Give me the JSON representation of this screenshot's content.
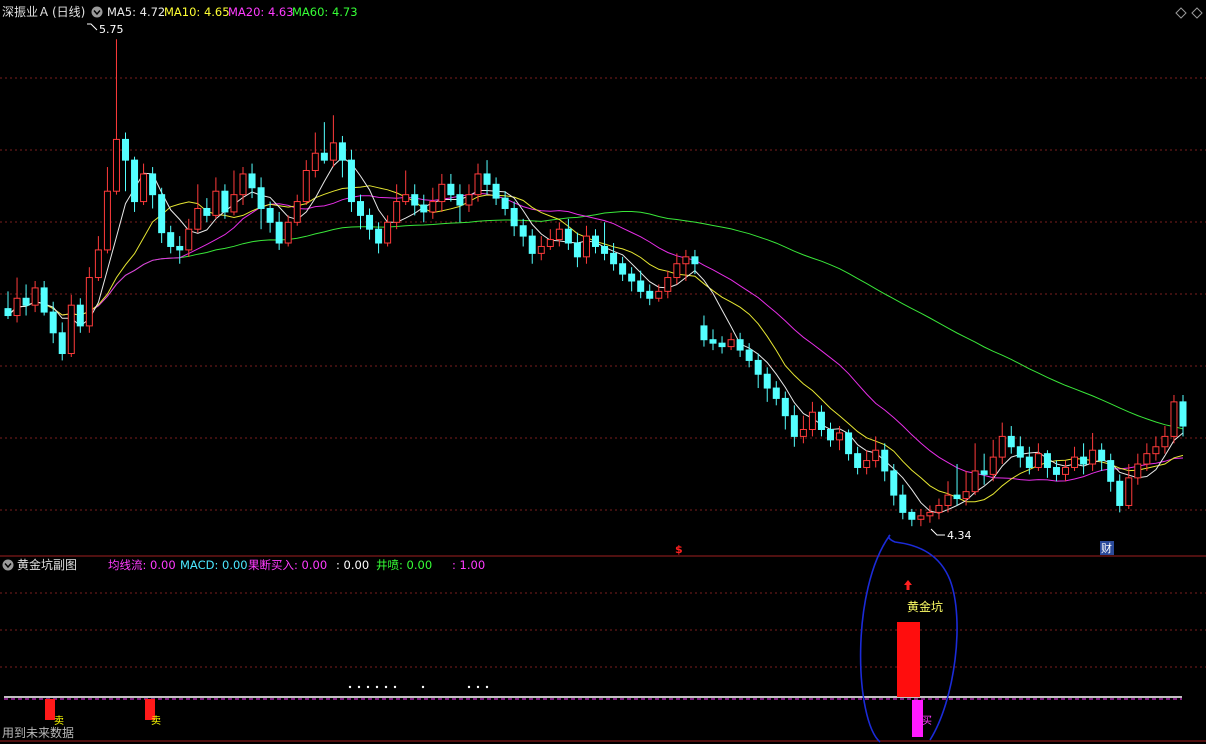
{
  "header": {
    "stock_name": "深振业Ａ",
    "period": "(日线)",
    "ma5": "MA5: 4.72",
    "ma10": "MA10: 4.65",
    "ma20": "MA20: 4.63",
    "ma60": "MA60: 4.73"
  },
  "main_chart": {
    "high_label": "5.75",
    "low_label": "4.34",
    "marker_dollar": "$",
    "marker_cai": "财"
  },
  "sub_panel": {
    "title": "黄金坑副图",
    "indicators": [
      {
        "label": "均线流: 0.00",
        "color": "#ff3cff"
      },
      {
        "label": "MACD: 0.00",
        "color": "#4ce8ff"
      },
      {
        "label": "果断买入: 0.00",
        "color": "#ff3cff"
      },
      {
        "label": ": 0.00",
        "color": "#ffffff"
      },
      {
        "label": "井喷: 0.00",
        "color": "#36ff36"
      },
      {
        "label": ": 1.00",
        "color": "#ff3cff"
      }
    ],
    "signal_label": "黄金坑",
    "buy_char": "买",
    "sell_char": "卖"
  },
  "footer": {
    "no_future": "用到未来数据"
  },
  "chart_data": {
    "type": "candlestick",
    "price_range": [
      4.3,
      5.8
    ],
    "high": 5.75,
    "low": 4.34,
    "candles": [
      [
        4.97,
        4.95,
        5.02,
        4.94
      ],
      [
        4.95,
        5.0,
        5.06,
        4.93
      ],
      [
        5.0,
        4.98,
        5.04,
        4.95
      ],
      [
        4.98,
        5.03,
        5.05,
        4.96
      ],
      [
        5.03,
        4.96,
        5.05,
        4.95
      ],
      [
        4.96,
        4.9,
        4.99,
        4.87
      ],
      [
        4.9,
        4.84,
        4.93,
        4.82
      ],
      [
        4.84,
        4.98,
        5.01,
        4.83
      ],
      [
        4.98,
        4.92,
        5.0,
        4.9
      ],
      [
        4.92,
        5.06,
        5.09,
        4.9
      ],
      [
        5.06,
        5.14,
        5.18,
        5.05
      ],
      [
        5.14,
        5.31,
        5.38,
        5.13
      ],
      [
        5.31,
        5.46,
        5.75,
        5.3
      ],
      [
        5.46,
        5.4,
        5.48,
        5.31
      ],
      [
        5.4,
        5.28,
        5.41,
        5.25
      ],
      [
        5.28,
        5.36,
        5.39,
        5.27
      ],
      [
        5.36,
        5.3,
        5.38,
        5.26
      ],
      [
        5.3,
        5.19,
        5.32,
        5.16
      ],
      [
        5.19,
        5.15,
        5.21,
        5.13
      ],
      [
        5.15,
        5.14,
        5.18,
        5.1
      ],
      [
        5.14,
        5.2,
        5.23,
        5.12
      ],
      [
        5.2,
        5.26,
        5.33,
        5.19
      ],
      [
        5.26,
        5.24,
        5.29,
        5.22
      ],
      [
        5.24,
        5.31,
        5.35,
        5.23
      ],
      [
        5.31,
        5.25,
        5.33,
        5.23
      ],
      [
        5.25,
        5.3,
        5.37,
        5.24
      ],
      [
        5.3,
        5.36,
        5.38,
        5.27
      ],
      [
        5.36,
        5.32,
        5.39,
        5.29
      ],
      [
        5.32,
        5.26,
        5.35,
        5.2
      ],
      [
        5.26,
        5.22,
        5.28,
        5.19
      ],
      [
        5.22,
        5.16,
        5.25,
        5.14
      ],
      [
        5.16,
        5.22,
        5.24,
        5.15
      ],
      [
        5.22,
        5.28,
        5.3,
        5.21
      ],
      [
        5.28,
        5.37,
        5.4,
        5.27
      ],
      [
        5.37,
        5.42,
        5.48,
        5.35
      ],
      [
        5.42,
        5.4,
        5.51,
        5.39
      ],
      [
        5.4,
        5.45,
        5.53,
        5.38
      ],
      [
        5.45,
        5.4,
        5.47,
        5.35
      ],
      [
        5.4,
        5.28,
        5.43,
        5.25
      ],
      [
        5.28,
        5.24,
        5.3,
        5.2
      ],
      [
        5.24,
        5.2,
        5.26,
        5.17
      ],
      [
        5.2,
        5.16,
        5.22,
        5.13
      ],
      [
        5.16,
        5.22,
        5.24,
        5.15
      ],
      [
        5.22,
        5.28,
        5.33,
        5.2
      ],
      [
        5.28,
        5.3,
        5.37,
        5.27
      ],
      [
        5.3,
        5.27,
        5.33,
        5.24
      ],
      [
        5.27,
        5.25,
        5.3,
        5.22
      ],
      [
        5.25,
        5.28,
        5.32,
        5.23
      ],
      [
        5.28,
        5.33,
        5.36,
        5.25
      ],
      [
        5.33,
        5.3,
        5.36,
        5.28
      ],
      [
        5.3,
        5.27,
        5.33,
        5.22
      ],
      [
        5.27,
        5.3,
        5.33,
        5.25
      ],
      [
        5.3,
        5.36,
        5.39,
        5.28
      ],
      [
        5.36,
        5.33,
        5.4,
        5.3
      ],
      [
        5.33,
        5.29,
        5.35,
        5.27
      ],
      [
        5.29,
        5.26,
        5.31,
        5.24
      ],
      [
        5.26,
        5.21,
        5.28,
        5.18
      ],
      [
        5.21,
        5.18,
        5.23,
        5.15
      ],
      [
        5.18,
        5.13,
        5.2,
        5.1
      ],
      [
        5.13,
        5.15,
        5.18,
        5.11
      ],
      [
        5.15,
        5.17,
        5.2,
        5.14
      ],
      [
        5.17,
        5.2,
        5.22,
        5.15
      ],
      [
        5.2,
        5.16,
        5.23,
        5.14
      ],
      [
        5.16,
        5.12,
        5.19,
        5.09
      ],
      [
        5.12,
        5.18,
        5.21,
        5.1
      ],
      [
        5.18,
        5.15,
        5.2,
        5.13
      ],
      [
        5.15,
        5.13,
        5.22,
        5.11
      ],
      [
        5.13,
        5.1,
        5.16,
        5.08
      ],
      [
        5.1,
        5.07,
        5.12,
        5.05
      ],
      [
        5.07,
        5.05,
        5.09,
        5.02
      ],
      [
        5.05,
        5.02,
        5.08,
        5.0
      ],
      [
        5.02,
        5.0,
        5.04,
        4.98
      ],
      [
        5.0,
        5.02,
        5.04,
        4.99
      ],
      [
        5.02,
        5.06,
        5.08,
        5.0
      ],
      [
        5.06,
        5.1,
        5.13,
        5.04
      ],
      [
        5.1,
        5.12,
        5.14,
        5.05
      ],
      [
        5.12,
        5.1,
        5.14,
        5.07
      ],
      [
        4.92,
        4.88,
        4.95,
        4.86
      ],
      [
        4.88,
        4.87,
        4.91,
        4.85
      ],
      [
        4.87,
        4.86,
        4.89,
        4.84
      ],
      [
        4.86,
        4.88,
        4.9,
        4.85
      ],
      [
        4.88,
        4.85,
        4.9,
        4.83
      ],
      [
        4.85,
        4.82,
        4.87,
        4.8
      ],
      [
        4.82,
        4.78,
        4.84,
        4.74
      ],
      [
        4.78,
        4.74,
        4.8,
        4.7
      ],
      [
        4.74,
        4.71,
        4.76,
        4.69
      ],
      [
        4.71,
        4.66,
        4.73,
        4.62
      ],
      [
        4.66,
        4.6,
        4.69,
        4.57
      ],
      [
        4.6,
        4.62,
        4.66,
        4.58
      ],
      [
        4.62,
        4.67,
        4.7,
        4.6
      ],
      [
        4.67,
        4.62,
        4.69,
        4.6
      ],
      [
        4.62,
        4.59,
        4.64,
        4.57
      ],
      [
        4.59,
        4.61,
        4.63,
        4.56
      ],
      [
        4.61,
        4.55,
        4.62,
        4.53
      ],
      [
        4.55,
        4.51,
        4.57,
        4.49
      ],
      [
        4.51,
        4.53,
        4.56,
        4.49
      ],
      [
        4.53,
        4.56,
        4.6,
        4.51
      ],
      [
        4.56,
        4.5,
        4.58,
        4.47
      ],
      [
        4.5,
        4.43,
        4.52,
        4.4
      ],
      [
        4.43,
        4.38,
        4.46,
        4.36
      ],
      [
        4.38,
        4.36,
        4.39,
        4.34
      ],
      [
        4.36,
        4.37,
        4.39,
        4.34
      ],
      [
        4.37,
        4.38,
        4.4,
        4.35
      ],
      [
        4.38,
        4.4,
        4.42,
        4.36
      ],
      [
        4.4,
        4.43,
        4.47,
        4.38
      ],
      [
        4.43,
        4.42,
        4.52,
        4.4
      ],
      [
        4.42,
        4.44,
        4.5,
        4.4
      ],
      [
        4.44,
        4.5,
        4.58,
        4.43
      ],
      [
        4.5,
        4.49,
        4.55,
        4.46
      ],
      [
        4.49,
        4.54,
        4.59,
        4.47
      ],
      [
        4.54,
        4.6,
        4.64,
        4.52
      ],
      [
        4.6,
        4.57,
        4.63,
        4.55
      ],
      [
        4.57,
        4.54,
        4.6,
        4.51
      ],
      [
        4.54,
        4.51,
        4.57,
        4.49
      ],
      [
        4.51,
        4.55,
        4.58,
        4.5
      ],
      [
        4.55,
        4.51,
        4.56,
        4.48
      ],
      [
        4.51,
        4.49,
        4.53,
        4.47
      ],
      [
        4.49,
        4.51,
        4.53,
        4.47
      ],
      [
        4.51,
        4.54,
        4.57,
        4.5
      ],
      [
        4.54,
        4.52,
        4.58,
        4.49
      ],
      [
        4.52,
        4.56,
        4.61,
        4.5
      ],
      [
        4.56,
        4.53,
        4.58,
        4.5
      ],
      [
        4.53,
        4.47,
        4.55,
        4.44
      ],
      [
        4.47,
        4.4,
        4.49,
        4.38
      ],
      [
        4.4,
        4.48,
        4.52,
        4.39
      ],
      [
        4.48,
        4.52,
        4.55,
        4.46
      ],
      [
        4.52,
        4.55,
        4.58,
        4.5
      ],
      [
        4.55,
        4.57,
        4.6,
        4.53
      ],
      [
        4.57,
        4.6,
        4.63,
        4.55
      ],
      [
        4.6,
        4.7,
        4.72,
        4.58
      ],
      [
        4.7,
        4.63,
        4.72,
        4.6
      ]
    ]
  }
}
